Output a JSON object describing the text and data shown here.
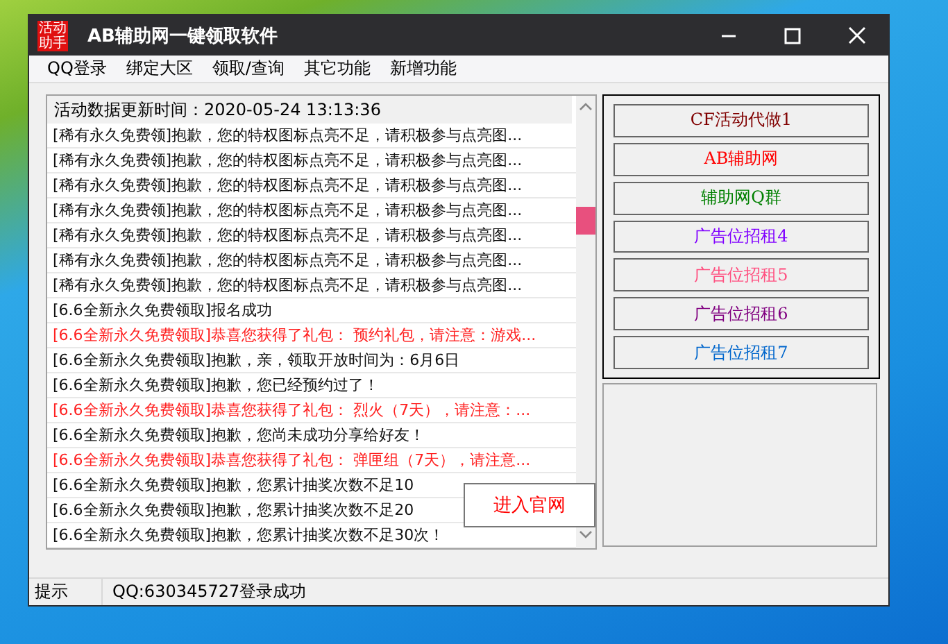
{
  "window": {
    "logo": "活动助手",
    "title": "AB辅助网一键领取软件"
  },
  "menu": [
    "QQ登录",
    "绑定大区",
    "领取/查询",
    "其它功能",
    "新增功能"
  ],
  "log": {
    "header": "活动数据更新时间：2020-05-24 13:13:36",
    "rows": [
      {
        "kind": "normal",
        "text": "[稀有永久免费领]抱歉，您的特权图标点亮不足，请积极参与点亮图..."
      },
      {
        "kind": "normal",
        "text": "[稀有永久免费领]抱歉，您的特权图标点亮不足，请积极参与点亮图..."
      },
      {
        "kind": "normal",
        "text": "[稀有永久免费领]抱歉，您的特权图标点亮不足，请积极参与点亮图..."
      },
      {
        "kind": "normal",
        "text": "[稀有永久免费领]抱歉，您的特权图标点亮不足，请积极参与点亮图..."
      },
      {
        "kind": "normal",
        "text": "[稀有永久免费领]抱歉，您的特权图标点亮不足，请积极参与点亮图..."
      },
      {
        "kind": "normal",
        "text": "[稀有永久免费领]抱歉，您的特权图标点亮不足，请积极参与点亮图..."
      },
      {
        "kind": "normal",
        "text": "[稀有永久免费领]抱歉，您的特权图标点亮不足，请积极参与点亮图..."
      },
      {
        "kind": "normal",
        "text": "[6.6全新永久免费领取]报名成功"
      },
      {
        "kind": "gift",
        "text": "[6.6全新永久免费领取]恭喜您获得了礼包： 预约礼包，请注意：游戏..."
      },
      {
        "kind": "normal",
        "text": "[6.6全新永久免费领取]抱歉，亲，领取开放时间为：6月6日"
      },
      {
        "kind": "normal",
        "text": "[6.6全新永久免费领取]抱歉，您已经预约过了！"
      },
      {
        "kind": "gift",
        "text": "[6.6全新永久免费领取]恭喜您获得了礼包： 烈火（7天），请注意：..."
      },
      {
        "kind": "normal",
        "text": "[6.6全新永久免费领取]抱歉，您尚未成功分享给好友！"
      },
      {
        "kind": "gift",
        "text": "[6.6全新永久免费领取]恭喜您获得了礼包： 弹匣组（7天），请注意..."
      },
      {
        "kind": "normal",
        "text": "[6.6全新永久免费领取]抱歉，您累计抽奖次数不足10"
      },
      {
        "kind": "normal",
        "text": "[6.6全新永久免费领取]抱歉，您累计抽奖次数不足20"
      },
      {
        "kind": "normal",
        "text": "[6.6全新永久免费领取]抱歉，您累计抽奖次数不足30次！"
      }
    ],
    "popup_button": "进入官网"
  },
  "side_buttons": [
    {
      "label": "CF活动代做1",
      "color": "#800000"
    },
    {
      "label": "AB辅助网",
      "color": "#ff0000"
    },
    {
      "label": "辅助网Q群",
      "color": "#008000"
    },
    {
      "label": "广告位招租4",
      "color": "#8000ff"
    },
    {
      "label": "广告位招租5",
      "color": "#ff5080"
    },
    {
      "label": "广告位招租6",
      "color": "#800080"
    },
    {
      "label": "广告位招租7",
      "color": "#0066cc"
    }
  ],
  "status_bar": {
    "label": "提示",
    "message": "QQ:630345727登录成功"
  }
}
